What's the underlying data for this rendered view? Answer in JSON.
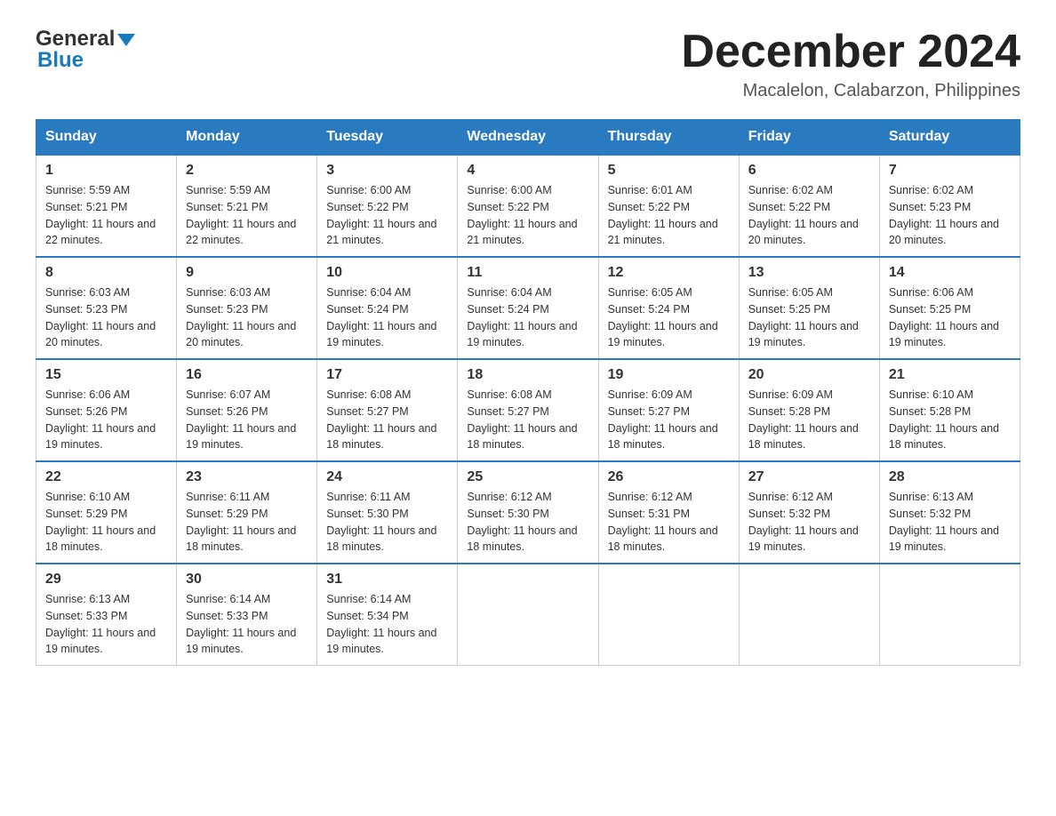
{
  "header": {
    "logo_general": "General",
    "logo_blue": "Blue",
    "title": "December 2024",
    "location": "Macalelon, Calabarzon, Philippines"
  },
  "columns": [
    "Sunday",
    "Monday",
    "Tuesday",
    "Wednesday",
    "Thursday",
    "Friday",
    "Saturday"
  ],
  "weeks": [
    [
      {
        "day": "1",
        "sunrise": "Sunrise: 5:59 AM",
        "sunset": "Sunset: 5:21 PM",
        "daylight": "Daylight: 11 hours and 22 minutes."
      },
      {
        "day": "2",
        "sunrise": "Sunrise: 5:59 AM",
        "sunset": "Sunset: 5:21 PM",
        "daylight": "Daylight: 11 hours and 22 minutes."
      },
      {
        "day": "3",
        "sunrise": "Sunrise: 6:00 AM",
        "sunset": "Sunset: 5:22 PM",
        "daylight": "Daylight: 11 hours and 21 minutes."
      },
      {
        "day": "4",
        "sunrise": "Sunrise: 6:00 AM",
        "sunset": "Sunset: 5:22 PM",
        "daylight": "Daylight: 11 hours and 21 minutes."
      },
      {
        "day": "5",
        "sunrise": "Sunrise: 6:01 AM",
        "sunset": "Sunset: 5:22 PM",
        "daylight": "Daylight: 11 hours and 21 minutes."
      },
      {
        "day": "6",
        "sunrise": "Sunrise: 6:02 AM",
        "sunset": "Sunset: 5:22 PM",
        "daylight": "Daylight: 11 hours and 20 minutes."
      },
      {
        "day": "7",
        "sunrise": "Sunrise: 6:02 AM",
        "sunset": "Sunset: 5:23 PM",
        "daylight": "Daylight: 11 hours and 20 minutes."
      }
    ],
    [
      {
        "day": "8",
        "sunrise": "Sunrise: 6:03 AM",
        "sunset": "Sunset: 5:23 PM",
        "daylight": "Daylight: 11 hours and 20 minutes."
      },
      {
        "day": "9",
        "sunrise": "Sunrise: 6:03 AM",
        "sunset": "Sunset: 5:23 PM",
        "daylight": "Daylight: 11 hours and 20 minutes."
      },
      {
        "day": "10",
        "sunrise": "Sunrise: 6:04 AM",
        "sunset": "Sunset: 5:24 PM",
        "daylight": "Daylight: 11 hours and 19 minutes."
      },
      {
        "day": "11",
        "sunrise": "Sunrise: 6:04 AM",
        "sunset": "Sunset: 5:24 PM",
        "daylight": "Daylight: 11 hours and 19 minutes."
      },
      {
        "day": "12",
        "sunrise": "Sunrise: 6:05 AM",
        "sunset": "Sunset: 5:24 PM",
        "daylight": "Daylight: 11 hours and 19 minutes."
      },
      {
        "day": "13",
        "sunrise": "Sunrise: 6:05 AM",
        "sunset": "Sunset: 5:25 PM",
        "daylight": "Daylight: 11 hours and 19 minutes."
      },
      {
        "day": "14",
        "sunrise": "Sunrise: 6:06 AM",
        "sunset": "Sunset: 5:25 PM",
        "daylight": "Daylight: 11 hours and 19 minutes."
      }
    ],
    [
      {
        "day": "15",
        "sunrise": "Sunrise: 6:06 AM",
        "sunset": "Sunset: 5:26 PM",
        "daylight": "Daylight: 11 hours and 19 minutes."
      },
      {
        "day": "16",
        "sunrise": "Sunrise: 6:07 AM",
        "sunset": "Sunset: 5:26 PM",
        "daylight": "Daylight: 11 hours and 19 minutes."
      },
      {
        "day": "17",
        "sunrise": "Sunrise: 6:08 AM",
        "sunset": "Sunset: 5:27 PM",
        "daylight": "Daylight: 11 hours and 18 minutes."
      },
      {
        "day": "18",
        "sunrise": "Sunrise: 6:08 AM",
        "sunset": "Sunset: 5:27 PM",
        "daylight": "Daylight: 11 hours and 18 minutes."
      },
      {
        "day": "19",
        "sunrise": "Sunrise: 6:09 AM",
        "sunset": "Sunset: 5:27 PM",
        "daylight": "Daylight: 11 hours and 18 minutes."
      },
      {
        "day": "20",
        "sunrise": "Sunrise: 6:09 AM",
        "sunset": "Sunset: 5:28 PM",
        "daylight": "Daylight: 11 hours and 18 minutes."
      },
      {
        "day": "21",
        "sunrise": "Sunrise: 6:10 AM",
        "sunset": "Sunset: 5:28 PM",
        "daylight": "Daylight: 11 hours and 18 minutes."
      }
    ],
    [
      {
        "day": "22",
        "sunrise": "Sunrise: 6:10 AM",
        "sunset": "Sunset: 5:29 PM",
        "daylight": "Daylight: 11 hours and 18 minutes."
      },
      {
        "day": "23",
        "sunrise": "Sunrise: 6:11 AM",
        "sunset": "Sunset: 5:29 PM",
        "daylight": "Daylight: 11 hours and 18 minutes."
      },
      {
        "day": "24",
        "sunrise": "Sunrise: 6:11 AM",
        "sunset": "Sunset: 5:30 PM",
        "daylight": "Daylight: 11 hours and 18 minutes."
      },
      {
        "day": "25",
        "sunrise": "Sunrise: 6:12 AM",
        "sunset": "Sunset: 5:30 PM",
        "daylight": "Daylight: 11 hours and 18 minutes."
      },
      {
        "day": "26",
        "sunrise": "Sunrise: 6:12 AM",
        "sunset": "Sunset: 5:31 PM",
        "daylight": "Daylight: 11 hours and 18 minutes."
      },
      {
        "day": "27",
        "sunrise": "Sunrise: 6:12 AM",
        "sunset": "Sunset: 5:32 PM",
        "daylight": "Daylight: 11 hours and 19 minutes."
      },
      {
        "day": "28",
        "sunrise": "Sunrise: 6:13 AM",
        "sunset": "Sunset: 5:32 PM",
        "daylight": "Daylight: 11 hours and 19 minutes."
      }
    ],
    [
      {
        "day": "29",
        "sunrise": "Sunrise: 6:13 AM",
        "sunset": "Sunset: 5:33 PM",
        "daylight": "Daylight: 11 hours and 19 minutes."
      },
      {
        "day": "30",
        "sunrise": "Sunrise: 6:14 AM",
        "sunset": "Sunset: 5:33 PM",
        "daylight": "Daylight: 11 hours and 19 minutes."
      },
      {
        "day": "31",
        "sunrise": "Sunrise: 6:14 AM",
        "sunset": "Sunset: 5:34 PM",
        "daylight": "Daylight: 11 hours and 19 minutes."
      },
      null,
      null,
      null,
      null
    ]
  ]
}
